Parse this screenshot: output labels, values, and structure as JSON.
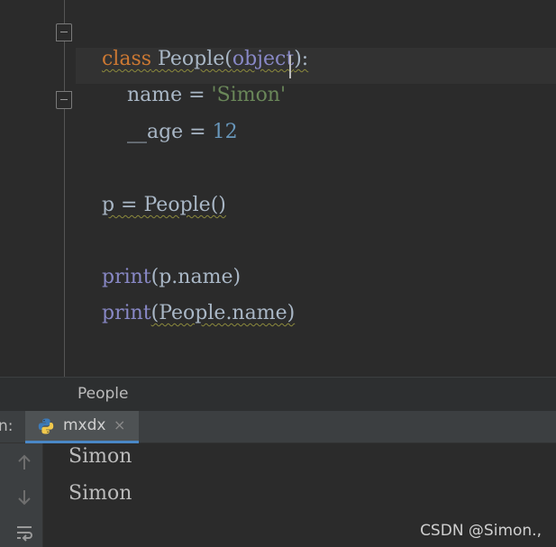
{
  "editor": {
    "lines": [
      {
        "tokens": [
          {
            "t": "class",
            "c": "kw"
          },
          {
            "t": " People(",
            "c": "pl"
          },
          {
            "t": "object",
            "c": "builtin"
          },
          {
            "t": "):",
            "c": "pl"
          }
        ]
      },
      {
        "tokens": [
          {
            "t": "    name = ",
            "c": "pl"
          },
          {
            "t": "'Simon'",
            "c": "str"
          }
        ]
      },
      {
        "tokens": [
          {
            "t": "    __age = ",
            "c": "pl"
          },
          {
            "t": "12",
            "c": "num"
          }
        ]
      },
      {
        "tokens": [
          {
            "t": "p = People()",
            "c": "pl"
          }
        ]
      },
      {
        "tokens": [
          {
            "t": "print",
            "c": "builtin"
          },
          {
            "t": "(p.name)",
            "c": "pl"
          }
        ]
      },
      {
        "tokens": [
          {
            "t": "print",
            "c": "builtin"
          },
          {
            "t": "(People.name)",
            "c": "pl"
          }
        ]
      }
    ]
  },
  "breadcrumb": {
    "label": "People"
  },
  "run": {
    "prefix": "n:",
    "tab_label": "mxdx",
    "tab_close": "×"
  },
  "console": {
    "output": [
      "Simon",
      "Simon"
    ]
  },
  "watermark": "CSDN @Simon.,",
  "colors": {
    "keyword": "#cc7832",
    "builtin": "#8888c6",
    "string": "#6a8759",
    "number": "#6897bb",
    "plain": "#a9b7c6",
    "background": "#2b2b2b"
  },
  "icons": [
    "fold-icon",
    "python-file-icon",
    "close-icon",
    "arrow-up-icon",
    "arrow-down-icon",
    "soft-wrap-icon"
  ]
}
